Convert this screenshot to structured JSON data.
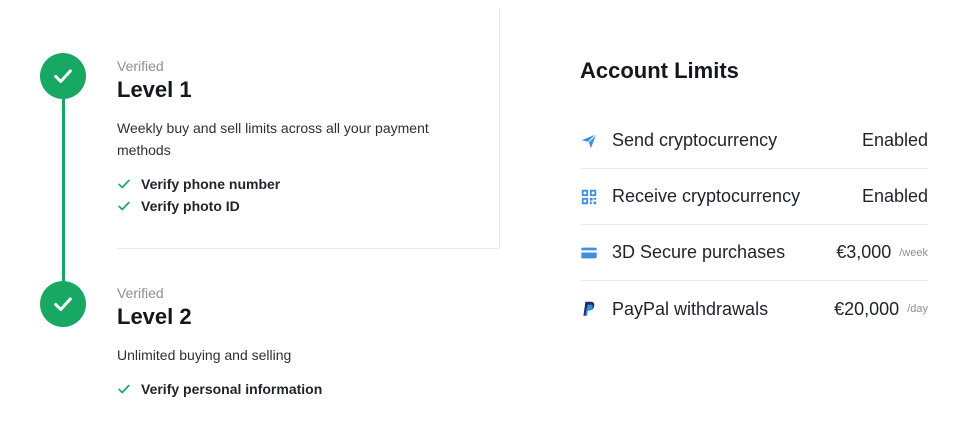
{
  "colors": {
    "accent": "#19a863",
    "icon_blue": "#3d8fe0",
    "paypal_dark": "#1b2f6b",
    "paypal_light": "#3a9ad9"
  },
  "levels": [
    {
      "status": "Verified",
      "title": "Level 1",
      "description": "Weekly buy and sell limits across all your payment methods",
      "requirements": [
        "Verify phone number",
        "Verify photo ID"
      ]
    },
    {
      "status": "Verified",
      "title": "Level 2",
      "description": "Unlimited buying and selling",
      "requirements": [
        "Verify personal information"
      ]
    }
  ],
  "account_limits": {
    "title": "Account Limits",
    "items": [
      {
        "icon": "send-icon",
        "label": "Send cryptocurrency",
        "value": "Enabled",
        "period": ""
      },
      {
        "icon": "qr-code-icon",
        "label": "Receive cryptocurrency",
        "value": "Enabled",
        "period": ""
      },
      {
        "icon": "credit-card-icon",
        "label": "3D Secure purchases",
        "value": "€3,000",
        "period": "/week"
      },
      {
        "icon": "paypal-icon",
        "label": "PayPal withdrawals",
        "value": "€20,000",
        "period": "/day"
      }
    ]
  }
}
